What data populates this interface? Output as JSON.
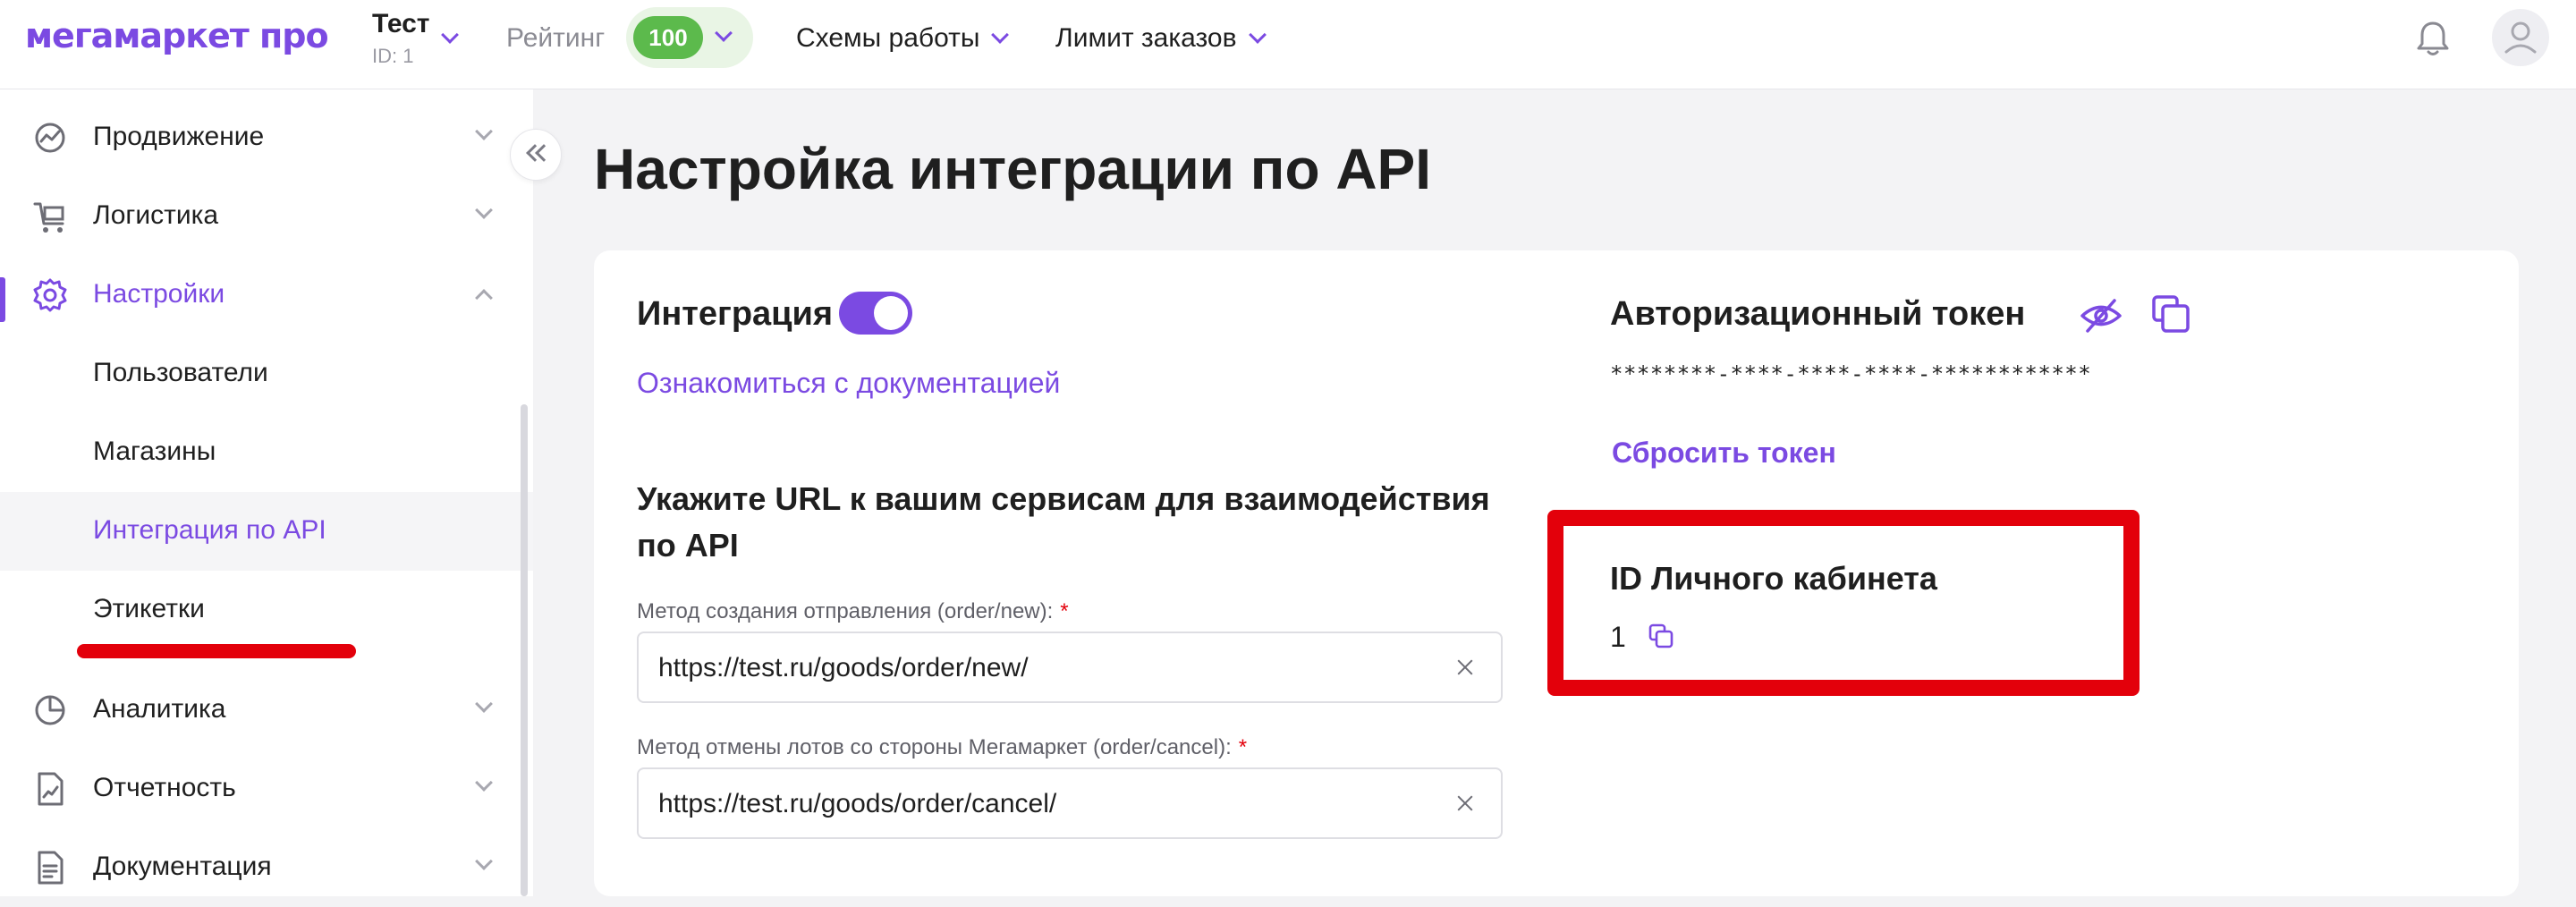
{
  "brand": {
    "logo_text": "мегамаркет про",
    "accent": "#7b4ae2",
    "alert_red": "#e3000b",
    "rating_green": "#5cba4c"
  },
  "header": {
    "account_name": "Тест",
    "account_id": "ID: 1",
    "rating_label": "Рейтинг",
    "rating_value": "100",
    "nav": [
      "Схемы работы",
      "Лимит заказов"
    ],
    "icons": [
      "bell-icon",
      "user-avatar-icon"
    ]
  },
  "sidebar": {
    "items": [
      {
        "label": "Продвижение",
        "icon": "promotion-chart-icon",
        "expanded": false
      },
      {
        "label": "Логистика",
        "icon": "cart-icon",
        "expanded": false
      },
      {
        "label": "Настройки",
        "icon": "gear-icon",
        "expanded": true,
        "active": true
      },
      {
        "label": "Аналитика",
        "icon": "pie-chart-icon",
        "expanded": false
      },
      {
        "label": "Отчетность",
        "icon": "report-icon",
        "expanded": false
      },
      {
        "label": "Документация",
        "icon": "document-icon",
        "expanded": false
      }
    ],
    "settings_children": [
      "Пользователи",
      "Магазины",
      "Интеграция по API",
      "Этикетки"
    ],
    "active_child": "Интеграция по API"
  },
  "main": {
    "page_title": "Настройка интеграции по API",
    "integration": {
      "title": "Интеграция",
      "enabled": true,
      "doc_link": "Ознакомиться с документацией"
    },
    "urls": {
      "title": "Укажите URL к вашим сервисам для взаимодействия по API",
      "fields": [
        {
          "label": "Метод создания отправления (order/new):",
          "required_mark": "*",
          "value": "https://test.ru/goods/order/new/"
        },
        {
          "label": "Метод отмены лотов со стороны Мегамаркет (order/cancel):",
          "required_mark": "*",
          "value": "https://test.ru/goods/order/cancel/"
        }
      ]
    },
    "token": {
      "title": "Авторизационный токен",
      "masked_value": "********-****-****-****-************",
      "reset_link": "Сбросить токен"
    },
    "cabinet": {
      "title": "ID Личного кабинета",
      "id_value": "1"
    }
  }
}
